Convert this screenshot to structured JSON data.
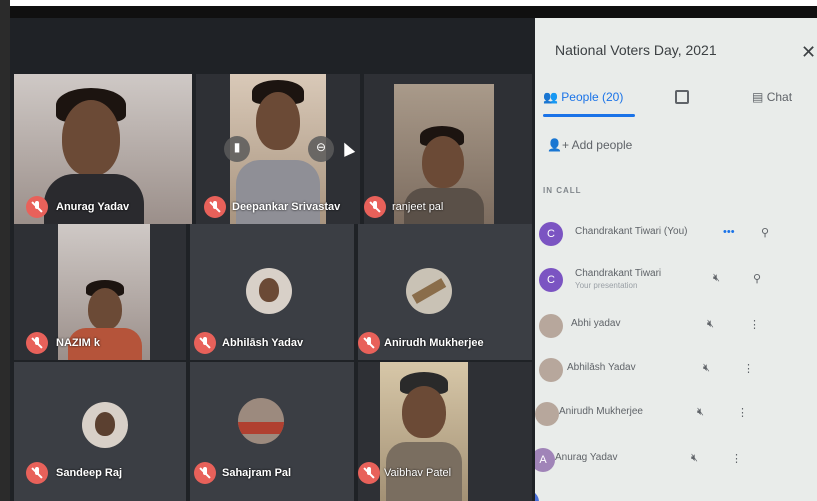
{
  "meeting": {
    "title": "National Voters Day, 2021"
  },
  "tiles": [
    {
      "name": "Anurag Yadav"
    },
    {
      "name": "Deepankar Srivastav"
    },
    {
      "name": "ranjeet pal"
    },
    {
      "name": "NAZIM k"
    },
    {
      "name": "Abhilāsh Yadav"
    },
    {
      "name": "Anirudh Mukherjee"
    },
    {
      "name": "Sandeep Raj"
    },
    {
      "name": "Sahajram Pal"
    },
    {
      "name": "Vaibhav Patel"
    }
  ],
  "panel": {
    "tabs": {
      "people_label": "People (20)",
      "chat_label": "Chat"
    },
    "add_people_label": "Add people",
    "section_label": "IN CALL",
    "close_icon": "close-icon",
    "participants": [
      {
        "initial": "C",
        "name": "Chandrakant Tiwari (You)",
        "sub": ""
      },
      {
        "initial": "C",
        "name": "Chandrakant Tiwari",
        "sub": "Your presentation"
      },
      {
        "initial": "",
        "name": "Abhi yadav",
        "sub": ""
      },
      {
        "initial": "",
        "name": "Abhilāsh Yadav",
        "sub": ""
      },
      {
        "initial": "",
        "name": "Anirudh Mukherjee",
        "sub": ""
      },
      {
        "initial": "A",
        "name": "Anurag Yadav",
        "sub": ""
      }
    ]
  },
  "colors": {
    "accent": "#1a73e8",
    "mute_badge": "#e8615a",
    "avatar_purple": "#7b54c2"
  }
}
